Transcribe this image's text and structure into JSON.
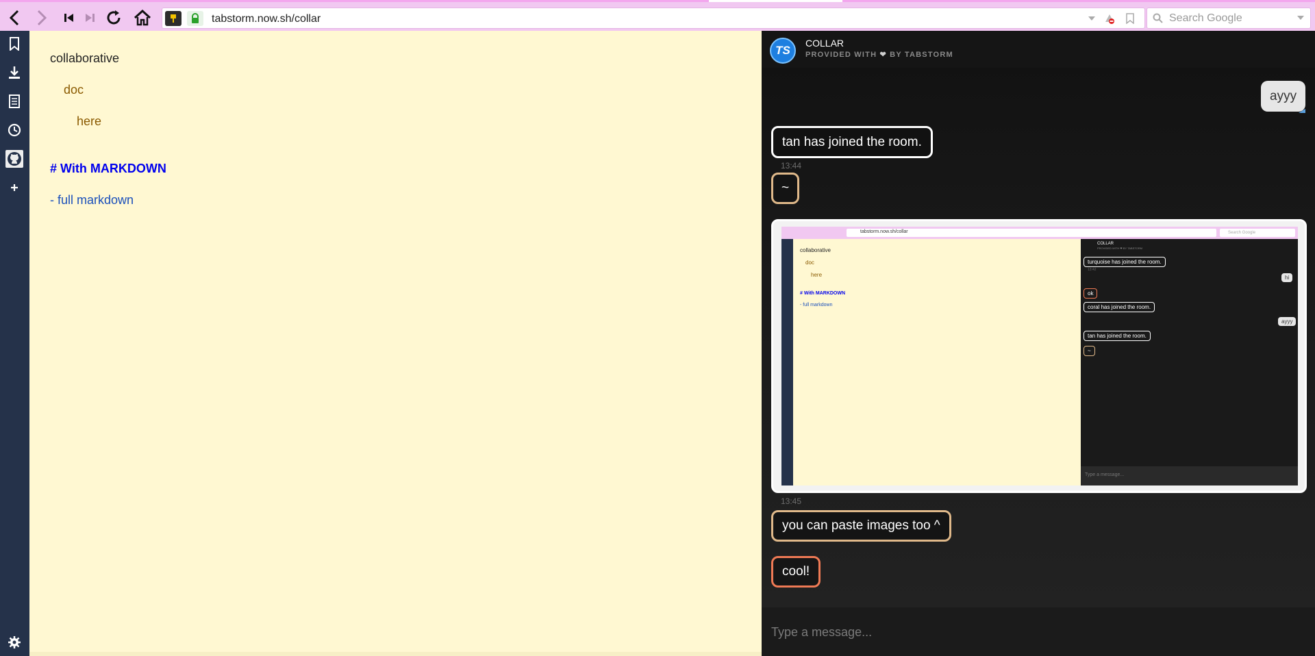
{
  "browser": {
    "url": "tabstorm.now.sh/collar",
    "search_placeholder": "Search Google",
    "icons": [
      "back-icon",
      "forward-icon",
      "first-icon",
      "last-icon",
      "reload-icon",
      "home-icon",
      "key-icon",
      "lock-icon",
      "dropdown-icon",
      "block-icon",
      "bookmark-star-icon",
      "search-icon"
    ]
  },
  "sidebar": {
    "icons": [
      "bookmark-icon",
      "download-icon",
      "notes-icon",
      "history-icon",
      "github-icon",
      "add-icon",
      "settings-icon"
    ]
  },
  "doc": {
    "lines": [
      {
        "text": "collaborative",
        "color": "#222222",
        "bold": false
      },
      {
        "text": "doc",
        "color": "#8a5a00",
        "bold": false
      },
      {
        "text": "here",
        "color": "#8a5a00",
        "bold": false
      },
      {
        "text": "# With MARKDOWN",
        "color": "#0000ee",
        "bold": true
      },
      {
        "text": "- full markdown",
        "color": "#1a4fbb",
        "bold": false
      }
    ]
  },
  "chat": {
    "title": "COLLAR",
    "subtitle_before": "PROVIDED WITH",
    "subtitle_heart": "❤",
    "subtitle_after": "BY TABSTORM",
    "logo_text": "TS",
    "messages": [
      {
        "text": "ayyy",
        "style": "self"
      },
      {
        "text": "tan has joined the room.",
        "style": "white"
      },
      {
        "text": "13:44",
        "kind": "timestamp"
      },
      {
        "text": "~",
        "style": "tan"
      },
      {
        "kind": "image"
      },
      {
        "text": "13:45",
        "kind": "timestamp"
      },
      {
        "text": "you can paste images too ^",
        "style": "tan"
      },
      {
        "text": "cool!",
        "style": "coral"
      }
    ],
    "composer_placeholder": "Type a message..."
  },
  "pasted_image": {
    "url": "tabstorm.now.sh/collar",
    "search": "Search Google",
    "doc_lines": [
      "collaborative",
      "doc",
      "here",
      "# With MARKDOWN",
      "- full markdown"
    ],
    "chat_title": "COLLAR",
    "chat_sub": "PROVIDED WITH ❤ BY TABSTORM",
    "bubbles": [
      "turquoise has joined the room.",
      "13:42",
      "hi",
      "ok",
      "coral has joined the room.",
      "ayyy",
      "tan has joined the room.",
      "~"
    ],
    "composer": "Type a message..."
  },
  "colors": {
    "toolbar": "#f1c8f1",
    "sidebar": "#25324a",
    "doc_bg": "#fff8d2",
    "chat_bg": "#1a1a1a",
    "tan": "#e0b98a",
    "coral": "#ef7a55"
  }
}
